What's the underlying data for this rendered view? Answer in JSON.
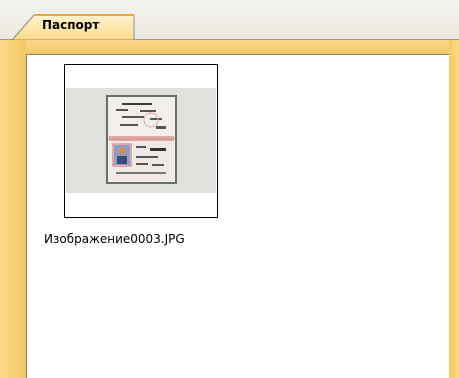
{
  "tabs": [
    {
      "label": "Паспорт",
      "active": true
    }
  ],
  "files": [
    {
      "name": "Изображение0003.JPG",
      "icon": "passport-photo-thumbnail"
    }
  ],
  "colors": {
    "frame": "#f6c968",
    "tab_strip": "#ebe9e0",
    "content_bg": "#ffffff"
  }
}
